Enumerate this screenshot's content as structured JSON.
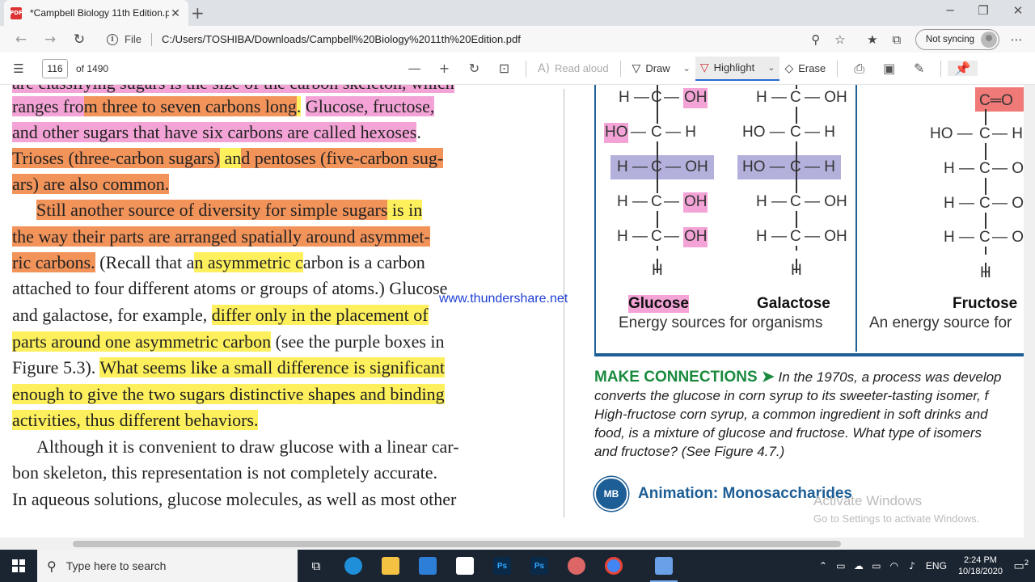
{
  "browser": {
    "tab_title": "*Campbell Biology 11th Edition.p",
    "tab_icon_text": "PDF",
    "address_scheme": "File",
    "url": "C:/Users/TOSHIBA/Downloads/Campbell%20Biology%2011th%20Edition.pdf",
    "sync_label": "Not syncing"
  },
  "pdf_toolbar": {
    "page_number": "116",
    "page_total": "of 1490",
    "read_aloud": "Read aloud",
    "draw": "Draw",
    "highlight": "Highlight",
    "erase": "Erase"
  },
  "page": {
    "text_lines": [
      "ranges from three to seven carbons long. Glucose, fructose,",
      "and other sugars that have six carbons are called hexoses.",
      "Trioses (three-carbon sugars) and pentoses (five-carbon sug-",
      "ars) are also common.",
      "Still another source of diversity for simple sugars is in",
      "the way their parts are arranged spatially around asymmet-",
      "ric carbons. (Recall that an asymmetric carbon is a carbon",
      "attached to four different atoms or groups of atoms.) Glucose",
      "and galactose, for example, differ only in the placement of",
      "parts around one asymmetric carbon (see the purple boxes in",
      "Figure 5.3). What seems like a small difference is significant",
      "enough to give the two sugars distinctive shapes and binding",
      "activities, thus different behaviors.",
      "Although it is convenient to draw glucose with a linear car-",
      "bon skeleton, this representation is not completely accurate.",
      "In aqueous solutions, glucose molecules, as well as most other"
    ],
    "watermark": "www.thundershare.net"
  },
  "figure": {
    "glucose_name": "Glucose",
    "galactose_name": "Galactose",
    "shared_desc": "Energy sources for organisms",
    "fructose_name": "Fructose",
    "fructose_desc": "An energy source for"
  },
  "make_connections": {
    "heading": "MAKE CONNECTIONS ➤",
    "lines": [
      " In the 1970s, a process was develop",
      "converts the glucose in corn syrup to its sweeter-tasting isomer, f",
      "High-fructose corn syrup, a common ingredient in soft drinks and",
      "food, is a mixture of glucose and fructose. What type of isomers",
      "and fructose? (See Figure 4.7.)"
    ]
  },
  "animation": {
    "badge": "MB",
    "title": "Animation: Monosaccharides"
  },
  "activate": {
    "title": "Activate Windows",
    "sub": "Go to Settings to activate Windows."
  },
  "taskbar": {
    "search_placeholder": "Type here to search",
    "clock_time": "2:24 PM",
    "clock_date": "10/18/2020",
    "lang": "ENG",
    "notif_count": "2"
  },
  "colors": {
    "pink_highlight": "#f4a3d6",
    "orange_highlight": "#f2935a",
    "yellow_highlight": "#fdf05c",
    "purple_box": "#b3b0dc",
    "accent_blue": "#1d5e96",
    "green_heading": "#1a8a3e"
  }
}
